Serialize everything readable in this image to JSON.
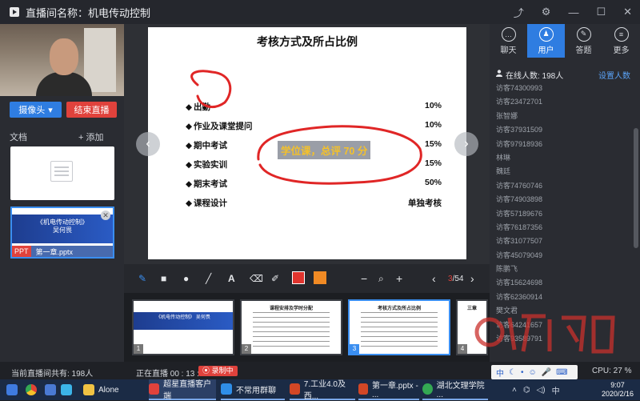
{
  "window": {
    "title": "直播间名称：机电传动控制"
  },
  "left": {
    "camera_button": "摄像头",
    "end_live_button": "结束直播",
    "docs_label": "文档",
    "add_label": "+ 添加",
    "ppt_doc": {
      "tag": "PPT",
      "filename": "第一章.pptx",
      "preview_title": "《机电传动控制》",
      "preview_author": "吴何畏"
    }
  },
  "slide": {
    "title": "考核方式及所占比例",
    "rows": [
      {
        "label": "出勤",
        "value": "10%"
      },
      {
        "label": "作业及课堂提问",
        "value": "10%"
      },
      {
        "label": "期中考试",
        "value": "15%"
      },
      {
        "label": "实验实训",
        "value": "15%"
      },
      {
        "label": "期末考试",
        "value": "50%"
      },
      {
        "label": "课程设计",
        "value": "单独考核"
      }
    ],
    "annotation": "学位课，总评 70 分"
  },
  "toolbar": {
    "minus": "−",
    "plus": "+",
    "page_current": "3",
    "page_total": "/54",
    "prev": "‹",
    "next": "›",
    "colors": {
      "active": "#e0342e",
      "secondary": "#f08a24"
    }
  },
  "thumbnails": [
    {
      "num": "1",
      "title": "《机电传动控制》 吴何畏"
    },
    {
      "num": "2",
      "title": "课程安排及学时分配"
    },
    {
      "num": "3",
      "title": "考核方式及所占比例"
    },
    {
      "num": "4",
      "title": "三章"
    }
  ],
  "right": {
    "tabs": [
      {
        "label": "聊天",
        "icon": "chat-icon"
      },
      {
        "label": "用户",
        "icon": "users-icon"
      },
      {
        "label": "答题",
        "icon": "pen-icon"
      },
      {
        "label": "更多",
        "icon": "menu-icon"
      }
    ],
    "online_count": "在线人数: 198人",
    "settings_link": "设置人数",
    "users": [
      "访客74300993",
      "访客23472701",
      "张智娜",
      "访客37931509",
      "访客97918936",
      "林琳",
      "魏廷",
      "访客74760746",
      "访客74903898",
      "访客57189676",
      "访客76187356",
      "访客31077507",
      "访客45079049",
      "陈鹏飞",
      "访客15624698",
      "访客62360914",
      "樊文君",
      "访客64241657",
      "访客93589791"
    ]
  },
  "statusbar": {
    "total_viewers": "当前直播间共有: 198人",
    "live_timer": "正在直播 00 : 13 : 42",
    "recording": "录制中",
    "cpu": "CPU:  27 %",
    "ime": "中"
  },
  "taskbar": {
    "items": [
      {
        "label": "Alone"
      },
      {
        "label": "超星直播客户端"
      },
      {
        "label": "不常用群聊"
      },
      {
        "label": "7.工业4.0及西..."
      },
      {
        "label": "第一章.pptx - ..."
      },
      {
        "label": "湖北文理学院 ..."
      }
    ],
    "time": "9:07",
    "date": "2020/2/16"
  }
}
